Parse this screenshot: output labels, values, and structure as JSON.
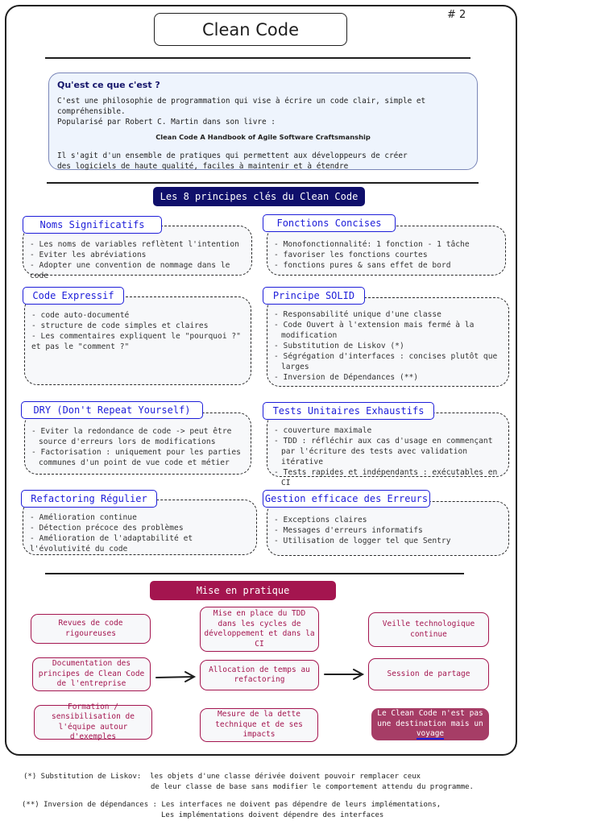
{
  "header": {
    "title": "Clean Code",
    "page_number": "# 2"
  },
  "intro": {
    "heading": "Qu'est ce que c'est ?",
    "line1": "C'est une philosophie de programmation qui vise à écrire un code clair, simple et compréhensible.",
    "line2": "Popularisé par Robert C. Martin dans son livre :",
    "book": "Clean Code A Handbook of Agile Software Craftsmanship",
    "line3": "Il s'agit d'un ensemble de pratiques qui permettent aux développeurs de créer",
    "line4": "des logiciels de haute qualité, faciles à maintenir et à étendre"
  },
  "principles_banner": "Les 8 principes clés du Clean Code",
  "principles": [
    {
      "title": "Noms Significatifs",
      "items": [
        "- Les noms de variables reflètent l'intention",
        "- Eviter les abréviations",
        "- Adopter une convention de nommage dans le code"
      ]
    },
    {
      "title": "Fonctions Concises",
      "items": [
        "- Monofonctionnalité: 1 fonction - 1 tâche",
        "- favoriser les fonctions courtes",
        "- fonctions pures & sans effet de bord"
      ]
    },
    {
      "title": "Code Expressif",
      "items": [
        "- code auto-documenté",
        "- structure de code simples et claires",
        "- Les commentaires expliquent le \"pourquoi ?\" et pas le \"comment ?\""
      ]
    },
    {
      "title": "Principe SOLID",
      "items": [
        "- Responsabilité unique d'une classe",
        "- Code Ouvert à l'extension mais fermé à la modification",
        "- Substitution de Liskov (*)",
        "- Ségrégation d'interfaces : concises plutôt que larges",
        "- Inversion de Dépendances (**)"
      ]
    },
    {
      "title": "DRY (Don't Repeat Yourself)",
      "items": [
        "- Eviter la redondance de code -> peut être source d'erreurs lors de modifications",
        "- Factorisation : uniquement pour les parties communes d'un point de vue code et métier"
      ]
    },
    {
      "title": "Tests Unitaires Exhaustifs",
      "items": [
        "- couverture maximale",
        "- TDD : réfléchir aux cas d'usage en commençant par l'écriture des tests avec validation itérative",
        "- Tests rapides et indépendants : exécutables en CI"
      ]
    },
    {
      "title": "Refactoring Régulier",
      "items": [
        "- Amélioration continue",
        "- Détection précoce des problèmes",
        "- Amélioration de l'adaptabilité et l'évolutivité du code"
      ]
    },
    {
      "title": "Gestion efficace des Erreurs",
      "items": [
        "- Exceptions claires",
        "- Messages d'erreurs informatifs",
        "- Utilisation de logger tel que Sentry"
      ]
    }
  ],
  "practice_banner": "Mise en pratique",
  "practices": {
    "code_review": "Revues de code rigoureuses",
    "tdd": "Mise en place du TDD dans les cycles de développement et dans la CI",
    "tech_watch": "Veille technologique continue",
    "documentation": "Documentation des principes de Clean Code de l'entreprise",
    "refactoring_time": "Allocation de temps au refactoring",
    "sharing": "Session de partage",
    "training": "Formation / sensibilisation de l'équipe autour d'exemples",
    "debt": "Mesure de la dette technique et de ses impacts",
    "motto_a": "Le Clean Code n'est pas une destination mais un ",
    "motto_b": "voyage"
  },
  "footnotes": {
    "liskov_label": "(*) Substitution de Liskov:",
    "liskov_1": "les objets d'une classe dérivée doivent pouvoir remplacer ceux",
    "liskov_2": "de leur classe de base sans modifier le comportement attendu du programme.",
    "dip_label": "(**) Inversion de dépendances :",
    "dip_1": "Les interfaces ne doivent pas dépendre de leurs implémentations,",
    "dip_2": "Les implémentations doivent dépendre des interfaces"
  },
  "colors": {
    "navy": "#0f0f6b",
    "blue_accent": "#1d1dd9",
    "practice_pink": "#a4154f",
    "motto_fill": "#a63d66",
    "intro_bg": "#eef4fd"
  }
}
